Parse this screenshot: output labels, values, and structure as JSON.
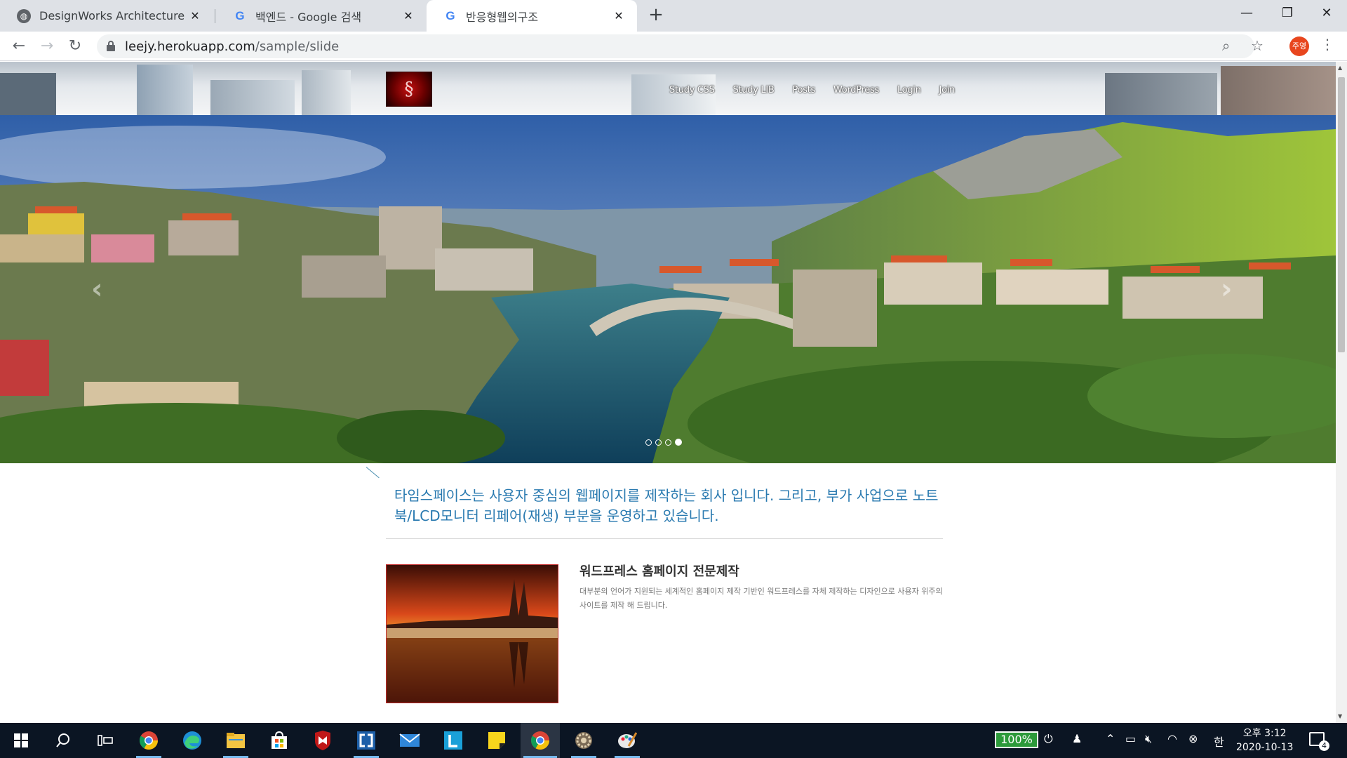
{
  "browser": {
    "tabs": [
      {
        "title": "DesignWorks Architecture Agen",
        "icon": "globe-icon",
        "active": false
      },
      {
        "title": "백엔드 - Google 검색",
        "icon": "google-icon",
        "active": false
      },
      {
        "title": "반응형웹의구조",
        "icon": "google-icon",
        "active": true
      }
    ],
    "new_tab_label": "+",
    "url": {
      "host": "leejy.herokuapp.com",
      "path": "/sample/slide"
    },
    "profile_label": "주영"
  },
  "site": {
    "logo_glyph": "§",
    "nav": [
      "Study CSS",
      "Study LIB",
      "Posts",
      "WordPress",
      "Login",
      "Join"
    ],
    "slider": {
      "active_dot": 4,
      "dot_count": 4,
      "prev_label": "‹",
      "next_label": "›"
    },
    "intro": "타임스페이스는 사용자 중심의 웹페이지를 제작하는 회사 입니다. 그리고, 부가 사업으로 노트북/LCD모니터 리페어(재생) 부분을 운영하고 있습니다.",
    "feature": {
      "title": "워드프레스 홈페이지 전문제작",
      "description": "대부분의 언어가 지원되는 세계적인 홈페이지 제작 기반인 워드프레스를 자체 제작하는 디자인으로 사용자 위주의 사이트를 제작 해 드립니다."
    }
  },
  "taskbar": {
    "apps": [
      "start-icon",
      "search-icon",
      "task-view-icon",
      "chrome-icon",
      "edge-icon",
      "file-explorer-icon",
      "store-icon",
      "mcafee-icon",
      "app-icon",
      "mail-icon",
      "line-icon",
      "sticky-notes-icon",
      "chrome-icon",
      "settings-icon",
      "paint-icon"
    ],
    "battery": "100%",
    "ime": "한",
    "time": "오후 3:12",
    "date": "2020-10-13",
    "notifications": "4"
  }
}
